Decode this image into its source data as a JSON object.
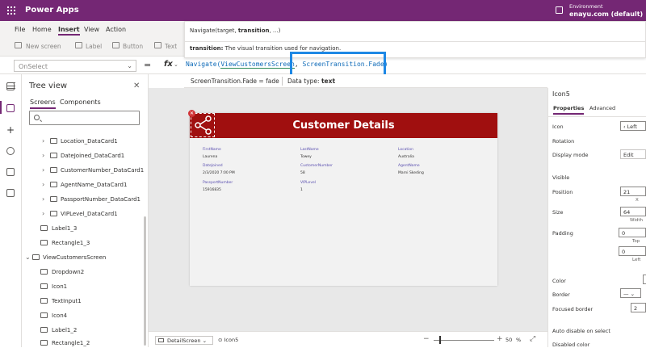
{
  "app": {
    "title": "Power Apps",
    "env_label": "Environment",
    "env_value": "enayu.com (default)"
  },
  "menu": [
    "File",
    "Home",
    "Insert",
    "View",
    "Action"
  ],
  "ribbon": {
    "new_screen": "New screen",
    "label": "Label",
    "button": "Button",
    "text": "Text"
  },
  "formula": {
    "property": "OnSelect",
    "fn": "Navigate(",
    "arg1": "ViewCustomersScreen",
    "sep": ", ",
    "arg2": "ScreenTransition.Fade",
    "close": ")"
  },
  "tooltip": {
    "sig_pre": "Navigate(target, ",
    "sig_bold": "transition",
    "sig_post": ", ...)",
    "desc_bold": "transition:",
    "desc_text": " The visual transition used for navigation."
  },
  "result": {
    "expr": "ScreenTransition.Fade  =  fade",
    "type_label": "Data type: ",
    "type_value": "text"
  },
  "tree": {
    "title": "Tree view",
    "tabs": [
      "Screens",
      "Components"
    ],
    "search_placeholder": "",
    "rows": [
      {
        "label": "Location_DataCard1"
      },
      {
        "label": "DateJoined_DataCard1"
      },
      {
        "label": "CustomerNumber_DataCard1"
      },
      {
        "label": "AgentName_DataCard1"
      },
      {
        "label": "PassportNumber_DataCard1"
      },
      {
        "label": "VIPLevel_DataCard1"
      },
      {
        "label": "Label1_3"
      },
      {
        "label": "Rectangle1_3"
      },
      {
        "label": "ViewCustomersScreen"
      },
      {
        "label": "Dropdown2"
      },
      {
        "label": "Icon1"
      },
      {
        "label": "TextInput1"
      },
      {
        "label": "Icon4"
      },
      {
        "label": "Label1_2"
      },
      {
        "label": "Rectangle1_2"
      }
    ]
  },
  "screen": {
    "title": "Customer Details",
    "fields": [
      {
        "label": "FirstName",
        "value": "Laurena"
      },
      {
        "label": "LastName",
        "value": "Towey"
      },
      {
        "label": "Location",
        "value": "Australia"
      },
      {
        "label": "DateJoined",
        "value": "2/3/2020 7:00 PM"
      },
      {
        "label": "CustomerNumber",
        "value": "58"
      },
      {
        "label": "AgentName",
        "value": "Marni Skeding"
      },
      {
        "label": "PassportNumber",
        "value": "15916835"
      },
      {
        "label": "VIPLevel",
        "value": "1"
      }
    ]
  },
  "bottom": {
    "screen": "DetailScreen",
    "control": "Icon5",
    "zoom": "50",
    "pct": "%"
  },
  "props": {
    "name": "Icon5",
    "tabs": [
      "Properties",
      "Advanced"
    ],
    "icon_label": "Icon",
    "icon_value": "Left",
    "rotation_label": "Rotation",
    "display_mode_label": "Display mode",
    "display_mode_value": "Edit",
    "visible_label": "Visible",
    "position_label": "Position",
    "position_x": "21",
    "x_label": "X",
    "size_label": "Size",
    "size_w": "64",
    "width_label": "Width",
    "padding_label": "Padding",
    "pad_top": "0",
    "top_label": "Top",
    "pad_left": "0",
    "left_label": "Left",
    "color_label": "Color",
    "border_label": "Border",
    "focused_border_label": "Focused border",
    "focused_border_value": "2",
    "auto_disable_label": "Auto disable on select",
    "disabled_color_label": "Disabled color"
  },
  "colors": {
    "brand": "#742774",
    "header_red": "#a00f0f",
    "highlight": "#1e88e5"
  }
}
